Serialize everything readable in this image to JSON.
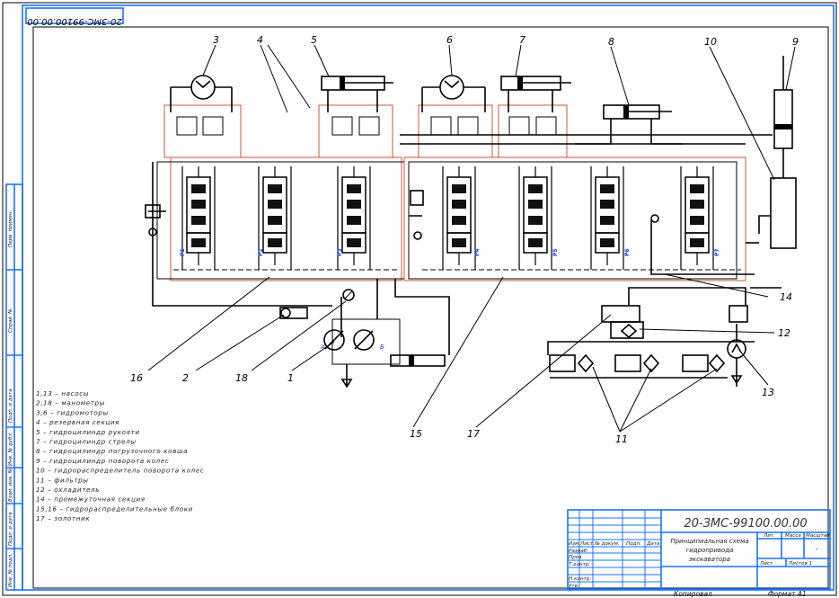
{
  "drawing": {
    "designation": "20-ЗМС-99100.00.00",
    "stamp_rotated": "20-ЗМС-99100.00.00",
    "title_lines": [
      "Принципиальная схема",
      "гидропривода",
      "экскаватора"
    ],
    "accent_color": "#1a73ff",
    "frame_color": "#c8553a"
  },
  "callouts": [
    "1",
    "2",
    "3",
    "4",
    "5",
    "6",
    "7",
    "8",
    "9",
    "10",
    "11",
    "12",
    "13",
    "14",
    "15",
    "16",
    "17",
    "18"
  ],
  "section_labels": [
    "P1",
    "P2",
    "P3",
    "P4",
    "P5",
    "P6",
    "P7"
  ],
  "pump_labels": [
    "А",
    "Б"
  ],
  "legend": [
    "1,13 – насосы",
    "2,18 – манометры",
    "3,6 – гидромоторы",
    "4 – резервная секция",
    "5 – гидроцилиндр рукояти",
    "7 – гидроцилиндр стрелы",
    "8 – гидроцилиндр погрузочного ковша",
    "9 – гидроцилиндр поворота колес",
    "10 – гидрораспределитель поворота колес",
    "11 – фильтры",
    "12 – охладитель",
    "14 – промежуточная секция",
    "15,16 – гидрораспределительные блоки",
    "17 – золотник"
  ],
  "title_block": {
    "header_cols": [
      "Изм.",
      "Лист",
      "№ докум.",
      "Подп.",
      "Дата"
    ],
    "rows": [
      "Разраб.",
      "Пров.",
      "Т.контр.",
      "Н.контр.",
      "Утв."
    ],
    "lit": "Лит.",
    "mass": "Масса",
    "scale": "Масштаб",
    "scale_value": "-",
    "sheet": "Лист",
    "sheets": "Листов 1",
    "copied": "Копировал",
    "format": "Формат A1"
  },
  "side_strip": [
    "Перв. примен.",
    "Справ. №",
    "Подп. и дата",
    "Инв. № дубл.",
    "Взам. инв. №",
    "Подп. и дата",
    "Инв. № подл."
  ]
}
